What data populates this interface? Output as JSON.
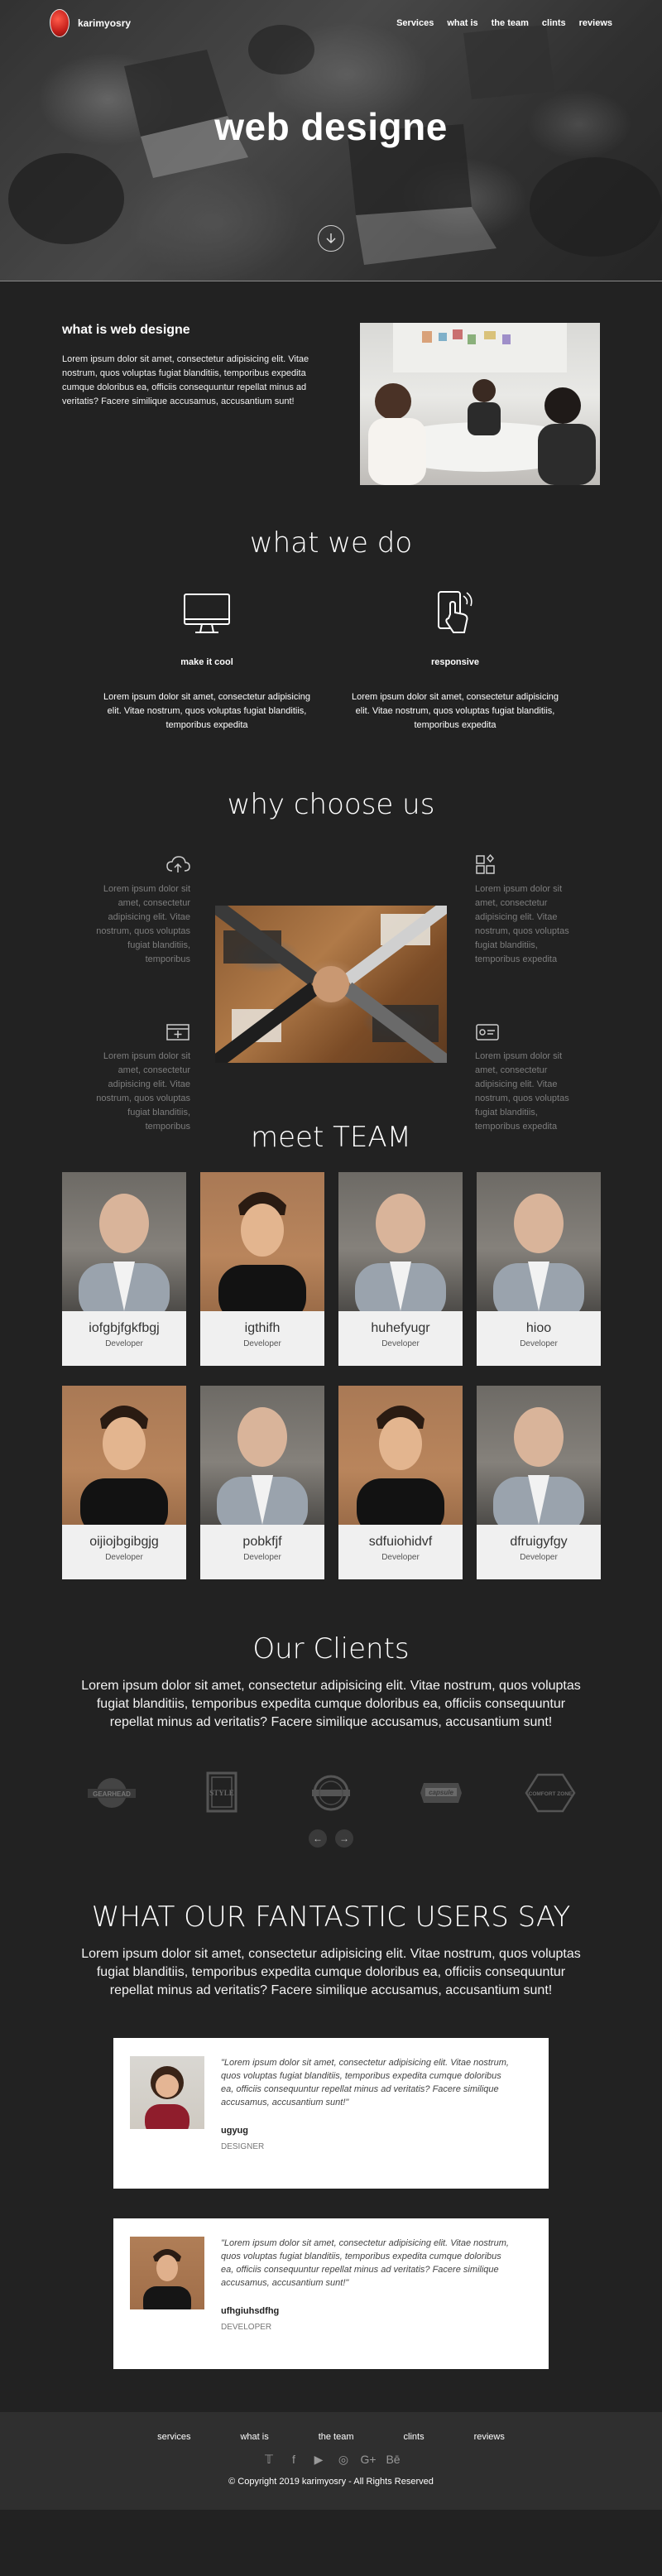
{
  "nav": {
    "brand": "karimyosry",
    "links": [
      "Services",
      "what is",
      "the team",
      "clints",
      "reviews"
    ]
  },
  "hero": {
    "title": "web designe"
  },
  "about": {
    "heading": "what is web designe",
    "text": "Lorem ipsum dolor sit amet, consectetur adipisicing elit. Vitae nostrum, quos voluptas fugiat blanditiis, temporibus expedita cumque doloribus ea, officiis consequuntur repellat minus ad veritatis? Facere similique accusamus, accusantium sunt!"
  },
  "what_we_do": {
    "title": "what we do",
    "services": [
      {
        "icon": "monitor-icon",
        "title": "make it cool",
        "text": "Lorem ipsum dolor sit amet, consectetur adipisicing elit. Vitae nostrum, quos voluptas fugiat blanditiis, temporibus expedita"
      },
      {
        "icon": "touch-phone-icon",
        "title": "responsive",
        "text": "Lorem ipsum dolor sit amet, consectetur adipisicing elit. Vitae nostrum, quos voluptas fugiat blanditiis, temporibus expedita"
      }
    ]
  },
  "why": {
    "title": "why choose us",
    "items": [
      {
        "icon": "cloud-upload-icon",
        "text": "Lorem ipsum dolor sit amet, consectetur adipisicing elit. Vitae nostrum, quos voluptas fugiat blanditiis, temporibus"
      },
      {
        "icon": "apps-grid-icon",
        "text": "Lorem ipsum dolor sit amet, consectetur adipisicing elit. Vitae nostrum, quos voluptas fugiat blanditiis, temporibus expedita"
      },
      {
        "icon": "add-box-icon",
        "text": "Lorem ipsum dolor sit amet, consectetur adipisicing elit. Vitae nostrum, quos voluptas fugiat blanditiis, temporibus"
      },
      {
        "icon": "id-card-icon",
        "text": "Lorem ipsum dolor sit amet, consectetur adipisicing elit. Vitae nostrum, quos voluptas fugiat blanditiis, temporibus expedita"
      }
    ]
  },
  "team": {
    "title": "meet TEAM",
    "members": [
      {
        "name": "iofgbjfgkfbgj",
        "role": "Developer",
        "photo": "bald"
      },
      {
        "name": "igthifh",
        "role": "Developer",
        "photo": "brown"
      },
      {
        "name": "huhefyugr",
        "role": "Developer",
        "photo": "bald"
      },
      {
        "name": "hioo",
        "role": "Developer",
        "photo": "bald"
      },
      {
        "name": "oijiojbgibgjg",
        "role": "Developer",
        "photo": "brown"
      },
      {
        "name": "pobkfjf",
        "role": "Developer",
        "photo": "bald"
      },
      {
        "name": "sdfuiohidvf",
        "role": "Developer",
        "photo": "brown"
      },
      {
        "name": "dfruigyfgy",
        "role": "Developer",
        "photo": "bald"
      }
    ]
  },
  "clients": {
    "title": "Our Clients",
    "text": "Lorem ipsum dolor sit amet, consectetur adipisicing elit. Vitae nostrum, quos voluptas fugiat blanditiis, temporibus expedita cumque doloribus ea, officiis consequuntur repellat minus ad veritatis? Facere similique accusamus, accusantium sunt!",
    "logos": [
      "GEARHEAD",
      "STYLE",
      "",
      "capsule",
      "COMFORT ZONE"
    ],
    "prev": "←",
    "next": "→"
  },
  "testimonials": {
    "title": "WHAT OUR FANTASTIC USERS SAY",
    "text": "Lorem ipsum dolor sit amet, consectetur adipisicing elit. Vitae nostrum, quos voluptas fugiat blanditiis, temporibus expedita cumque doloribus ea, officiis consequuntur repellat minus ad veritatis? Facere similique accusamus, accusantium sunt!",
    "items": [
      {
        "quote": "\"Lorem ipsum dolor sit amet, consectetur adipisicing elit. Vitae nostrum, quos voluptas fugiat blanditiis, temporibus expedita cumque doloribus ea, officiis consequuntur repellat minus ad veritatis? Facere similique accusamus, accusantium sunt!\"",
        "name": "ugyug",
        "role": "DESIGNER"
      },
      {
        "quote": "\"Lorem ipsum dolor sit amet, consectetur adipisicing elit. Vitae nostrum, quos voluptas fugiat blanditiis, temporibus expedita cumque doloribus ea, officiis consequuntur repellat minus ad veritatis? Facere similique accusamus, accusantium sunt!\"",
        "name": "ufhgiuhsdfhg",
        "role": "DEVELOPER"
      }
    ]
  },
  "footer": {
    "links": [
      "services",
      "what is",
      "the team",
      "clints",
      "reviews"
    ],
    "socials": [
      "twitter-icon",
      "facebook-icon",
      "youtube-icon",
      "instagram-icon",
      "google-plus-icon",
      "behance-icon"
    ],
    "social_glyphs": [
      "𝕋",
      "f",
      "▶",
      "◎",
      "G+",
      "Bē"
    ],
    "copyright": "© Copyright 2019 karimyosry - All Rights Reserved"
  }
}
